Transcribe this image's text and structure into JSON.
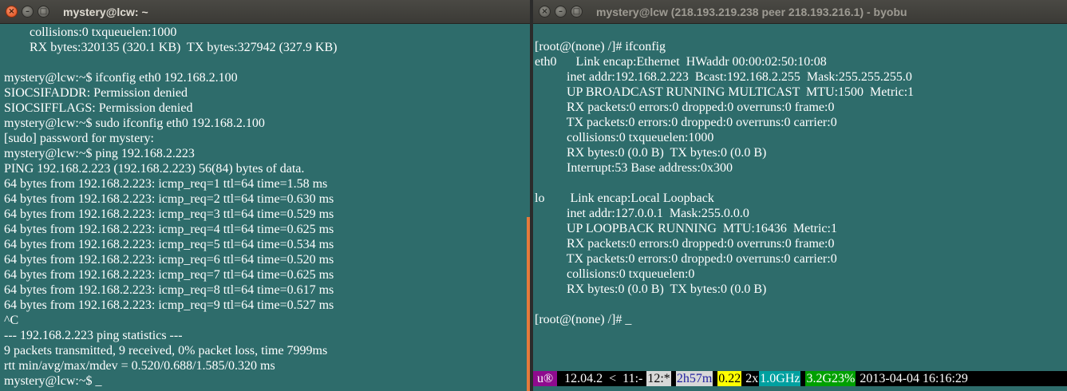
{
  "left_window": {
    "title": "mystery@lcw: ~",
    "lines": [
      "        collisions:0 txqueuelen:1000",
      "        RX bytes:320135 (320.1 KB)  TX bytes:327942 (327.9 KB)",
      "",
      "mystery@lcw:~$ ifconfig eth0 192.168.2.100",
      "SIOCSIFADDR: Permission denied",
      "SIOCSIFFLAGS: Permission denied",
      "mystery@lcw:~$ sudo ifconfig eth0 192.168.2.100",
      "[sudo] password for mystery:",
      "mystery@lcw:~$ ping 192.168.2.223",
      "PING 192.168.2.223 (192.168.2.223) 56(84) bytes of data.",
      "64 bytes from 192.168.2.223: icmp_req=1 ttl=64 time=1.58 ms",
      "64 bytes from 192.168.2.223: icmp_req=2 ttl=64 time=0.630 ms",
      "64 bytes from 192.168.2.223: icmp_req=3 ttl=64 time=0.529 ms",
      "64 bytes from 192.168.2.223: icmp_req=4 ttl=64 time=0.625 ms",
      "64 bytes from 192.168.2.223: icmp_req=5 ttl=64 time=0.534 ms",
      "64 bytes from 192.168.2.223: icmp_req=6 ttl=64 time=0.520 ms",
      "64 bytes from 192.168.2.223: icmp_req=7 ttl=64 time=0.625 ms",
      "64 bytes from 192.168.2.223: icmp_req=8 ttl=64 time=0.617 ms",
      "64 bytes from 192.168.2.223: icmp_req=9 ttl=64 time=0.527 ms",
      "^C",
      "--- 192.168.2.223 ping statistics ---",
      "9 packets transmitted, 9 received, 0% packet loss, time 7999ms",
      "rtt min/avg/max/mdev = 0.520/0.688/1.585/0.320 ms",
      "mystery@lcw:~$ _"
    ]
  },
  "right_window": {
    "title": "mystery@lcw (218.193.219.238 peer 218.193.216.1) - byobu",
    "lines": [
      "[root@(none) /]# ifconfig",
      "eth0      Link encap:Ethernet  HWaddr 00:00:02:50:10:08",
      "          inet addr:192.168.2.223  Bcast:192.168.2.255  Mask:255.255.255.0",
      "          UP BROADCAST RUNNING MULTICAST  MTU:1500  Metric:1",
      "          RX packets:0 errors:0 dropped:0 overruns:0 frame:0",
      "          TX packets:0 errors:0 dropped:0 overruns:0 carrier:0",
      "          collisions:0 txqueuelen:1000",
      "          RX bytes:0 (0.0 B)  TX bytes:0 (0.0 B)",
      "          Interrupt:53 Base address:0x300",
      "",
      "lo        Link encap:Local Loopback",
      "          inet addr:127.0.0.1  Mask:255.0.0.0",
      "          UP LOOPBACK RUNNING  MTU:16436  Metric:1",
      "          RX packets:0 errors:0 dropped:0 overruns:0 frame:0",
      "          TX packets:0 errors:0 dropped:0 overruns:0 carrier:0",
      "          collisions:0 txqueuelen:0",
      "          RX bytes:0 (0.0 B)  TX bytes:0 (0.0 B)",
      "",
      "[root@(none) /]# _"
    ],
    "statusbar": [
      {
        "text": " u® ",
        "bg": "#8e0b8e",
        "fg": "#ffffff"
      },
      {
        "text": "  12.04.2  <  11:- ",
        "bg": "#000000",
        "fg": "#ffffff"
      },
      {
        "text": "12:*",
        "bg": "#d8d8d8",
        "fg": "#000000"
      },
      {
        "text": " ",
        "bg": "#000000",
        "fg": "#ffffff"
      },
      {
        "text": "2h57m",
        "bg": "#d8d8d8",
        "fg": "#2020a0"
      },
      {
        "text": " ",
        "bg": "#000000",
        "fg": "#ffffff"
      },
      {
        "text": "0.22",
        "bg": "#ffff00",
        "fg": "#000000"
      },
      {
        "text": " 2x",
        "bg": "#000000",
        "fg": "#ffffff"
      },
      {
        "text": "1.0GHz",
        "bg": "#00a0a0",
        "fg": "#ffffff"
      },
      {
        "text": " ",
        "bg": "#000000",
        "fg": "#ffffff"
      },
      {
        "text": "3.2G23%",
        "bg": "#00a000",
        "fg": "#ffffff"
      },
      {
        "text": " 2013-04-04 16:16:29",
        "bg": "#000000",
        "fg": "#ffffff"
      }
    ]
  },
  "icons": {
    "close": "×",
    "minimize": "–",
    "maximize": "□"
  }
}
